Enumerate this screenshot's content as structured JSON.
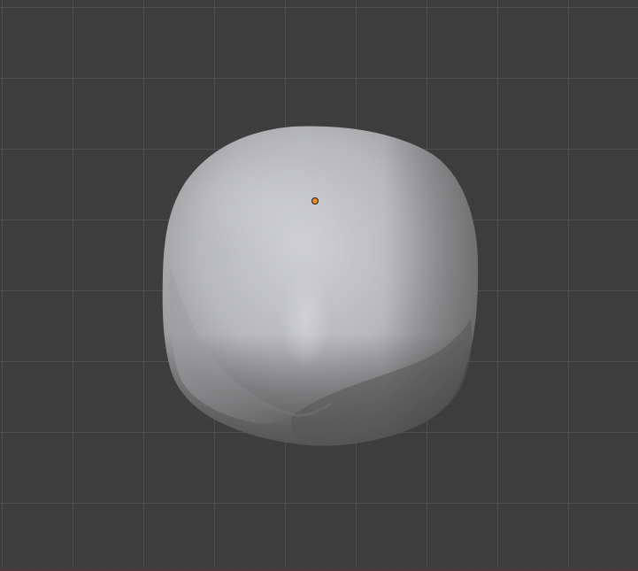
{
  "viewport": {
    "background_color": "#3d3d3d",
    "grid_major_color": "#5a5a5a",
    "grid_minor_color": "#464646"
  },
  "object": {
    "base_color": "#b8b9bc",
    "shadow_color": "#5e5c5c",
    "highlight_color": "#cfd0d3"
  },
  "origin_point": {
    "color": "#f08a24",
    "icon": "object-origin-dot-icon"
  }
}
